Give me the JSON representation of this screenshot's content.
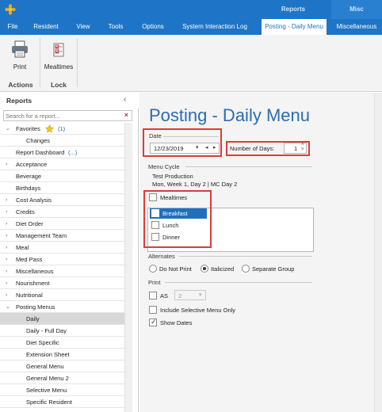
{
  "titlebar": {
    "ctx_reports": "Reports",
    "ctx_misc": "Misc"
  },
  "menu": {
    "tabs": [
      {
        "label": "File"
      },
      {
        "label": "Resident"
      },
      {
        "label": "View"
      },
      {
        "label": "Tools"
      },
      {
        "label": "Options"
      },
      {
        "label": "System Interaction Log"
      },
      {
        "label": "Posting - Daily Menu"
      },
      {
        "label": "Miscellaneous"
      }
    ]
  },
  "ribbon": {
    "print_label": "Print",
    "mealtimes_label": "Mealtimes",
    "group_actions": "Actions",
    "group_lock": "Lock"
  },
  "reports_panel": {
    "title": "Reports",
    "search_placeholder": "Search for a report...",
    "favorites_count": "(1)",
    "dashboard_suffix": "(...)",
    "items": [
      {
        "label": "Favorites"
      },
      {
        "label": "Changes"
      },
      {
        "label": "Report Dashboard"
      },
      {
        "label": "Acceptance"
      },
      {
        "label": "Beverage"
      },
      {
        "label": "Birthdays"
      },
      {
        "label": "Cost Analysis"
      },
      {
        "label": "Credits"
      },
      {
        "label": "Diet Order"
      },
      {
        "label": "Management Team"
      },
      {
        "label": "Meal"
      },
      {
        "label": "Med Pass"
      },
      {
        "label": "Miscellaneous"
      },
      {
        "label": "Nourishment"
      },
      {
        "label": "Nutritional"
      },
      {
        "label": "Posting Menus"
      },
      {
        "label": "Daily"
      },
      {
        "label": "Daily - Full Day"
      },
      {
        "label": "Diet Specific"
      },
      {
        "label": "Extension Sheet"
      },
      {
        "label": "General Menu"
      },
      {
        "label": "General Menu 2"
      },
      {
        "label": "Selective Menu"
      },
      {
        "label": "Specific Resident"
      }
    ]
  },
  "main": {
    "title": "Posting - Daily Menu",
    "date_label": "Date",
    "date_value": "12/23/2019",
    "days_label": "Number of Days:",
    "days_value": "1",
    "menu_cycle_label": "Menu Cycle",
    "menu_cycle_line1": "Test Production",
    "menu_cycle_line2": "Mon, Week 1, Day 2 | MC Day 2",
    "mealtimes_label": "Mealtimes",
    "meals": [
      "Breakfast",
      "Lunch",
      "Dinner"
    ],
    "alternates_label": "Alternates",
    "alt_options": [
      "Do Not Print",
      "Italicized",
      "Separate Group"
    ],
    "print_label": "Print",
    "as_label": "AS",
    "as_value": "2",
    "include_selective": "Include Selective Menu Only",
    "show_dates": "Show Dates"
  }
}
